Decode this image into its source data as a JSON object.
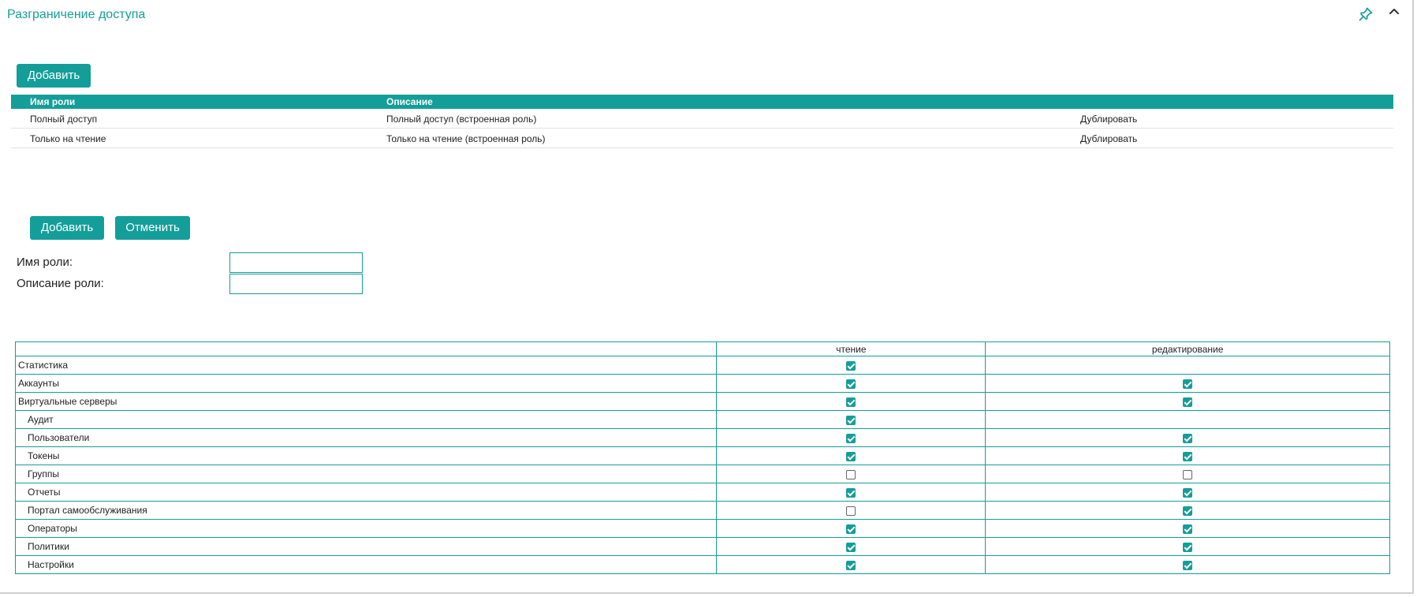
{
  "panel": {
    "title": "Разграничение доступа",
    "pin_icon": "pin-icon",
    "collapse_icon": "chevron-up-icon",
    "accent_color": "#149e99"
  },
  "roles": {
    "add_label": "Добавить",
    "columns": {
      "name": "Имя роли",
      "description": "Описание"
    },
    "rows": [
      {
        "name": "Полный доступ",
        "description": "Полный доступ (встроенная роль)",
        "action": "Дублировать"
      },
      {
        "name": "Только на чтение",
        "description": "Только на чтение (встроенная роль)",
        "action": "Дублировать"
      }
    ]
  },
  "form": {
    "add_label": "Добавить",
    "cancel_label": "Отменить",
    "name_label": "Имя роли:",
    "name_value": "",
    "description_label": "Описание роли:",
    "description_value": ""
  },
  "permissions": {
    "columns": {
      "read": "чтение",
      "edit": "редактирование"
    },
    "rows": [
      {
        "name": "Статистика",
        "sub": false,
        "read": true,
        "edit": null
      },
      {
        "name": "Аккаунты",
        "sub": false,
        "read": true,
        "edit": true
      },
      {
        "name": "Виртуальные серверы",
        "sub": false,
        "read": true,
        "edit": true
      },
      {
        "name": "Аудит",
        "sub": true,
        "read": true,
        "edit": null
      },
      {
        "name": "Пользователи",
        "sub": true,
        "read": true,
        "edit": true
      },
      {
        "name": "Токены",
        "sub": true,
        "read": true,
        "edit": true
      },
      {
        "name": "Группы",
        "sub": true,
        "read": false,
        "edit": false
      },
      {
        "name": "Отчеты",
        "sub": true,
        "read": true,
        "edit": true
      },
      {
        "name": "Портал самообслуживания",
        "sub": true,
        "read": false,
        "edit": true
      },
      {
        "name": "Операторы",
        "sub": true,
        "read": true,
        "edit": true
      },
      {
        "name": "Политики",
        "sub": true,
        "read": true,
        "edit": true
      },
      {
        "name": "Настройки",
        "sub": true,
        "read": true,
        "edit": true
      }
    ]
  }
}
